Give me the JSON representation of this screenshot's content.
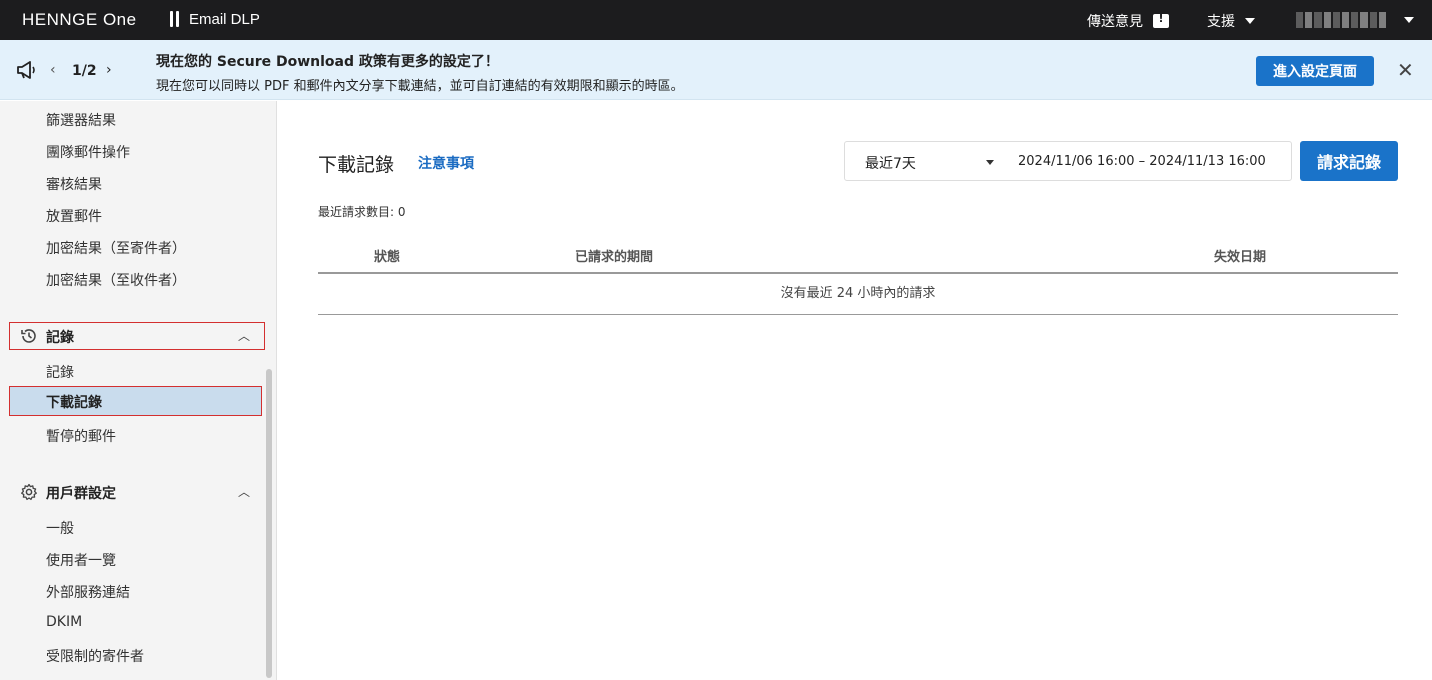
{
  "topbar": {
    "logo": "HENNGE One",
    "product": "Email DLP",
    "feedback_label": "傳送意見",
    "support_label": "支援"
  },
  "announcement": {
    "page": "1/2",
    "title": "現在您的 Secure Download 政策有更多的設定了！",
    "body": "現在您可以同時以 PDF 和郵件內文分享下載連結，並可自訂連結的有效期限和顯示的時區。",
    "button_label": "進入設定頁面"
  },
  "sidebar": {
    "top_items": [
      "篩選器結果",
      "團隊郵件操作",
      "審核結果",
      "放置郵件",
      "加密結果（至寄件者）",
      "加密結果（至收件者）"
    ],
    "group_records": {
      "label": "記錄",
      "items": [
        "記錄",
        "下載記錄",
        "暫停的郵件"
      ]
    },
    "group_user": {
      "label": "用戶群設定",
      "items": [
        "一般",
        "使用者一覽",
        "外部服務連結",
        "DKIM",
        "受限制的寄件者"
      ]
    }
  },
  "main": {
    "title": "下載記錄",
    "notice_link": "注意事項",
    "range_select": "最近7天",
    "range_dates": "2024/11/06  16:00  –  2024/11/13  16:00",
    "request_button": "請求記錄",
    "recent_count": "最近請求數目: 0",
    "table": {
      "headers": [
        "狀態",
        "已請求的期間",
        "失效日期"
      ],
      "empty_message": "沒有最近 24 小時內的請求"
    }
  }
}
